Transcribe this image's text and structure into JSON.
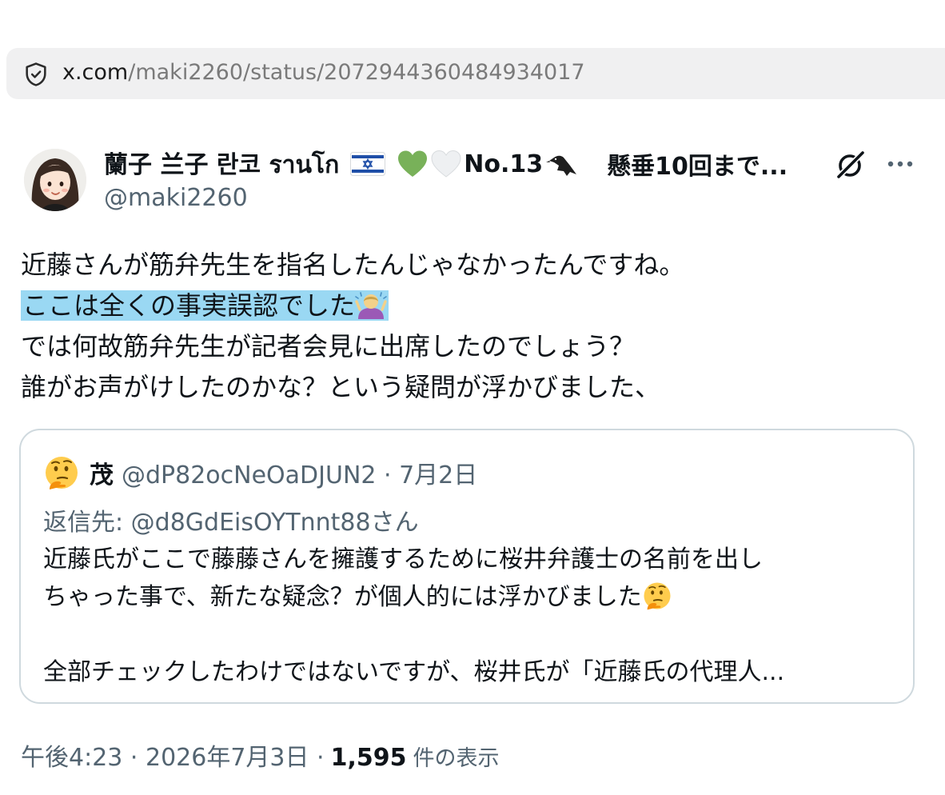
{
  "browser": {
    "url_host": "x.com",
    "url_path": "/maki2260/status/2072944360484934017"
  },
  "post": {
    "author_name_a": "蘭子 兰子 란코 รานโก",
    "author_name_b": "No.13",
    "author_name_c": "懸垂10回まで...",
    "handle": "@maki2260",
    "text_lines": [
      "近藤さんが筋弁先生を指名したんじゃなかったんですね。",
      "ここは全くの事実誤認でした",
      "では何故筋弁先生が記者会見に出席したのでしょう？",
      "誰がお声がけしたのかな？という疑問が浮かびました、"
    ],
    "highlight_color": "#9ad8f3"
  },
  "quote": {
    "author_name": "茂",
    "meta": "@dP82ocNeOaDJUN2 · 7月2日",
    "reply_label": "返信先: ",
    "reply_mention": "@d8GdEisOYTnnt88さん",
    "body_lines": [
      "近藤氏がここで藤藤さんを擁護するために桜井弁護士の名前を出し",
      "ちゃった事で、新たな疑念？が個人的には浮かびました",
      "",
      "全部チェックしたわけではないですが、桜井氏が「近藤氏の代理人..."
    ]
  },
  "footer": {
    "time_date": "午後4:23 · 2026年7月3日 ·",
    "views_count": "1,595",
    "views_label": "件の表示"
  },
  "icons": {
    "shield": "shield-icon",
    "grok": "grok-icon",
    "more": "more-dots-icon",
    "flag": "israel-flag-icon",
    "green_heart": "green-heart-icon",
    "white_heart": "white-heart-icon",
    "crow": "black-bird-icon",
    "person_gesture": "person-gesturing-icon",
    "thinking": "thinking-face-icon"
  }
}
